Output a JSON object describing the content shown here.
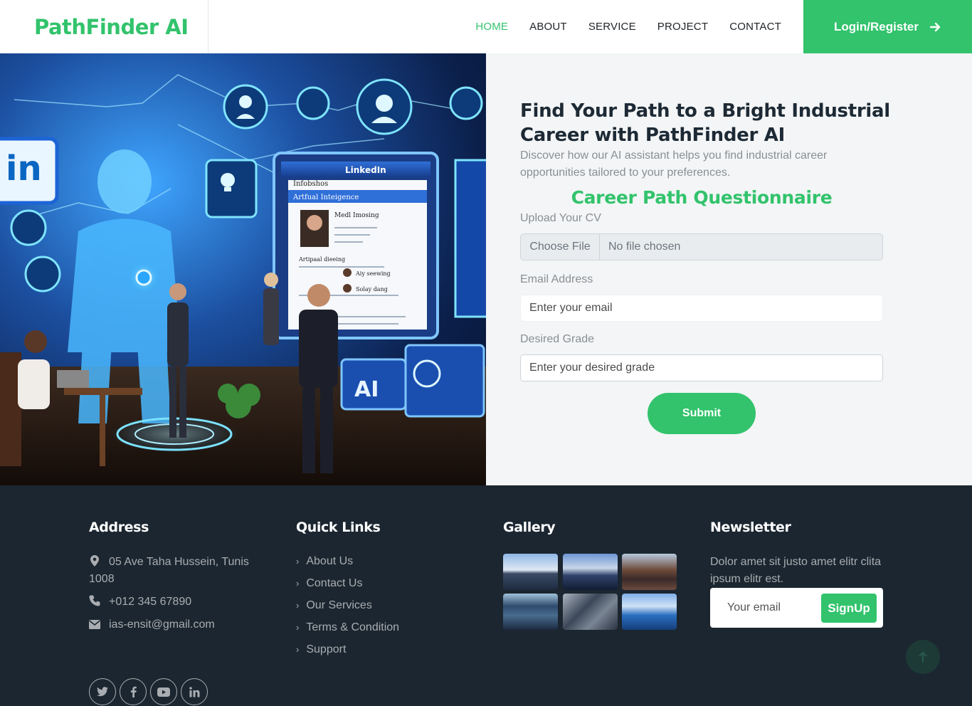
{
  "brand": "PathFinder AI",
  "nav": {
    "items": [
      {
        "label": "HOME"
      },
      {
        "label": "ABOUT"
      },
      {
        "label": "SERVICE"
      },
      {
        "label": "PROJECT"
      },
      {
        "label": "CONTACT"
      }
    ],
    "login_label": "Login/Register"
  },
  "hero": {
    "title": "Find Your Path to a Bright Industrial Career with PathFinder AI",
    "subtitle": "Discover how our AI assistant helps you find industrial career opportunities tailored to your preferences.",
    "questionnaire_title": "Career Path Questionnaire",
    "cv_label": "Upload Your CV",
    "file_button": "Choose File",
    "file_status": "No file chosen",
    "email_label": "Email Address",
    "email_placeholder": "Enter your email",
    "grade_label": "Desired Grade",
    "grade_placeholder": "Enter your desired grade",
    "submit_label": "Submit",
    "image_texts": {
      "linkedin_badge": "in",
      "screen_header": "LinkedIn",
      "screen_line1": "Infobshos",
      "screen_line2": "Artfual Inteigence",
      "screen_line3": "Medl Imosing",
      "screen_line4": "Artipaal dieeing",
      "screen_line5": "Aiy seewing",
      "screen_line6": "Solay dang",
      "ai_screen": "AI"
    }
  },
  "footer": {
    "address_title": "Address",
    "address": "05 Ave Taha Hussein, Tunis 1008",
    "phone": "+012 345 67890",
    "email": "ias-ensit@gmail.com",
    "quick_title": "Quick Links",
    "quick_links": [
      {
        "label": "About Us"
      },
      {
        "label": "Contact Us"
      },
      {
        "label": "Our Services"
      },
      {
        "label": "Terms & Condition"
      },
      {
        "label": "Support"
      }
    ],
    "gallery_title": "Gallery",
    "newsletter_title": "Newsletter",
    "newsletter_text": "Dolor amet sit justo amet elitr clita ipsum elitr est.",
    "newsletter_placeholder": "Your email",
    "signup_label": "SignUp"
  },
  "colors": {
    "accent": "#32c36c",
    "footer_bg": "#1b2630",
    "panel_bg": "#f3f5f6"
  }
}
